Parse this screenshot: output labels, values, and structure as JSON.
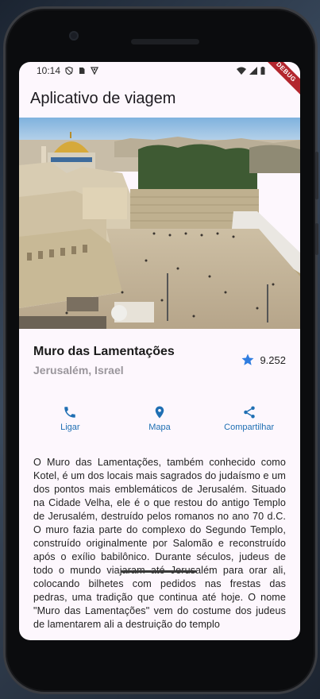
{
  "status": {
    "time": "10:14",
    "debug_banner": "DEBUG"
  },
  "appbar": {
    "title": "Aplicativo de viagem"
  },
  "place": {
    "name": "Muro das Lamentações",
    "location": "Jerusalém, Israel",
    "rating": "9.252"
  },
  "actions": [
    {
      "label": "Ligar",
      "icon": "phone-icon"
    },
    {
      "label": "Mapa",
      "icon": "location-pin-icon"
    },
    {
      "label": "Compartilhar",
      "icon": "share-icon"
    }
  ],
  "description": "O Muro das Lamentações, também conhecido como Kotel, é um dos locais mais sagrados do judaísmo e um dos pontos mais emblemáticos de Jerusalém. Situado na Cidade Velha, ele é o que restou do antigo Templo de Jerusalém, destruído pelos romanos no ano 70 d.C. O muro fazia parte do complexo do Segundo Templo, construído originalmente por Salomão e reconstruído após o exílio babilônico. Durante séculos, judeus de todo o mundo viajaram até Jerusalém para orar ali, colocando bilhetes com pedidos nas frestas das pedras, uma tradição que continua até hoje. O nome \"Muro das Lamentações\" vem do costume dos judeus de lamentarem ali a destruição do templo",
  "colors": {
    "accent": "#1f6fb3",
    "screen_bg": "#fdf7fd",
    "debug_red": "#b3262e"
  }
}
